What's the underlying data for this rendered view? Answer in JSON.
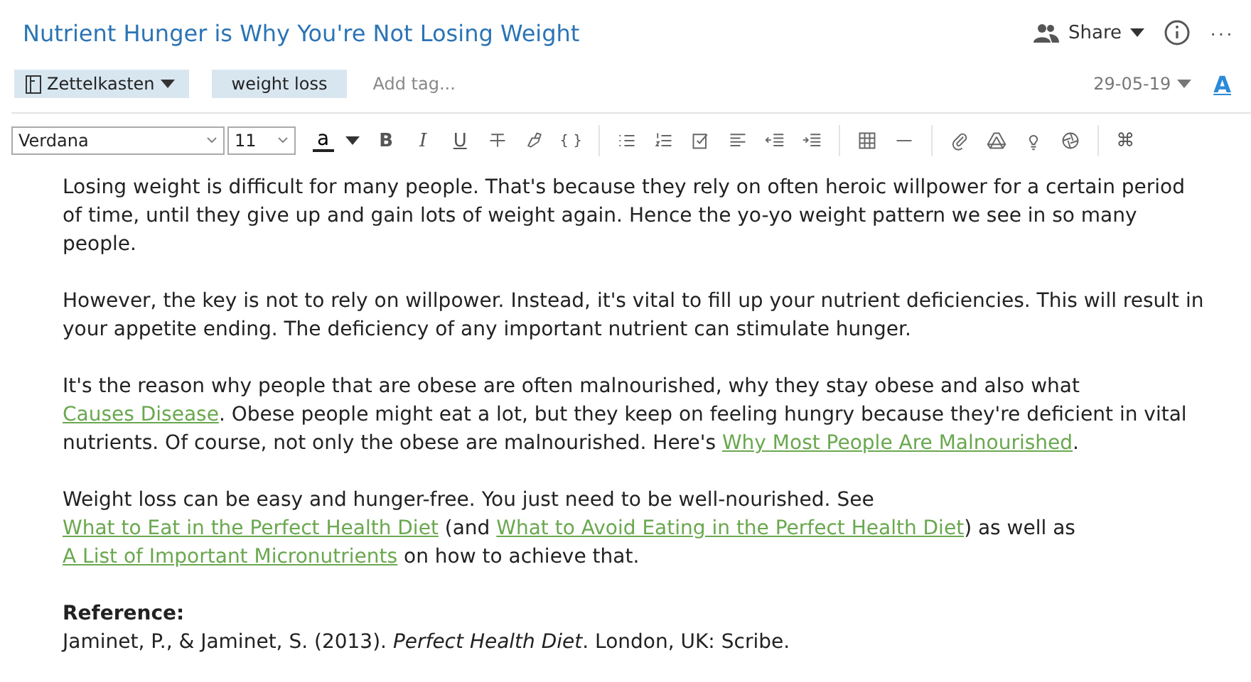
{
  "title": "Nutrient Hunger is Why You're Not Losing Weight",
  "header_actions": {
    "share": "Share",
    "more": "···"
  },
  "notebook": "Zettelkasten",
  "tags": [
    "weight loss"
  ],
  "tag_input": {
    "placeholder": "Add tag..."
  },
  "date": "29-05-19",
  "font_style_button": "A",
  "toolbar": {
    "font": "Verdana",
    "size": "11",
    "color_label": "a",
    "bold": "B",
    "italic": "I",
    "underline": "U",
    "code": "{ }",
    "command": "⌘"
  },
  "paragraphs": [
    [
      {
        "text": "Losing weight is difficult for many people. That's because they rely on often heroic willpower for a certain period of time, until they give up and gain lots of weight again. Hence the yo-yo weight pattern we see in so many people.",
        "link": false
      }
    ],
    [
      {
        "text": "However, the key is not to rely on willpower. Instead, it's vital to fill up your nutrient deficiencies. This will result in your appetite ending. The deficiency of any important nutrient can stimulate hunger.",
        "link": false
      }
    ],
    [
      {
        "text": "It's the reason why people that are obese are often malnourished, why they stay obese and also what ",
        "link": false
      },
      {
        "text": "Causes Disease",
        "link": true
      },
      {
        "text": ". Obese people might eat a lot, but they keep on feeling hungry because they're deficient in vital nutrients. Of course, not only the obese are malnourished. Here's ",
        "link": false
      },
      {
        "text": "Why Most People Are Malnourished",
        "link": true
      },
      {
        "text": ".",
        "link": false
      }
    ],
    [
      {
        "text": "Weight loss can be easy and hunger-free. You just need to be well-nourished. See ",
        "link": false
      },
      {
        "text": "What to Eat in the Perfect Health Diet",
        "link": true
      },
      {
        "text": " (and ",
        "link": false
      },
      {
        "text": "What to Avoid Eating in the Perfect Health Diet",
        "link": true
      },
      {
        "text": ") as well as ",
        "link": false
      },
      {
        "text": "A List of Important Micronutrients",
        "link": true
      },
      {
        "text": " on how to achieve that.",
        "link": false
      }
    ]
  ],
  "reference": {
    "heading": "Reference:",
    "citation": "Jaminet, P., & Jaminet, S. (2013). *Perfect Health Diet*. London, UK: Scribe."
  }
}
